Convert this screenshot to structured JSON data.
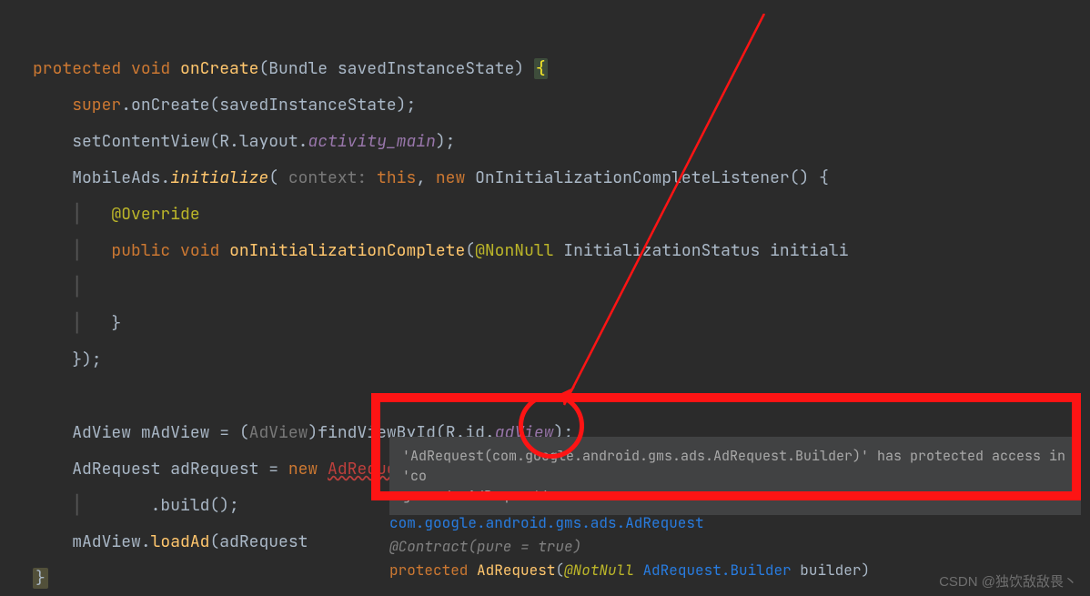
{
  "kw": {
    "protected": "protected",
    "void": "void",
    "super": "super",
    "this": "this",
    "new": "new",
    "public": "public"
  },
  "fn": {
    "onCreate": "onCreate",
    "initialize": "initialize",
    "onInitializationComplete": "onInitializationComplete",
    "loadAd": "loadAd",
    "setContentView": "setContentView",
    "findViewById": "findViewById",
    "build": "build"
  },
  "id": {
    "Bundle": "Bundle",
    "savedInstanceState": "savedInstanceState",
    "savedInstanceStateArg": "savedInstanceState",
    "R": "R",
    "layout": "layout",
    "MobileAds": "MobileAds",
    "contextHint": "context:",
    "OnListener": "OnInitializationCompleteListener",
    "InitStatus": "InitializationStatus",
    "initParam": "initiali",
    "AdView": "AdView",
    "mAdView": "mAdView",
    "id": "id",
    "adView": "adView",
    "AdRequest": "AdRequest",
    "adRequest": "adRequest",
    "Builder": "Builder",
    "adRequestArg": "adRequest",
    "mAdView2": "mAdView"
  },
  "fld": {
    "activity_main": "activity_main"
  },
  "ann": {
    "Override": "@Override",
    "NonNull": "@NonNull"
  },
  "popup": {
    "line1": "'AdRequest(com.google.android.gms.ads.AdRequest.Builder)' has protected access in 'co",
    "line2": "gms.ads.AdRequest'"
  },
  "doc": {
    "pkg": "com.google.android.gms.ads.AdRequest",
    "contract": "@Contract(pure = true)",
    "sig_pre": "protected ",
    "sig_name": "AdRequest",
    "sig_paren": "(",
    "sig_ann": "@NotNull",
    "sig_type": " AdRequest.Builder ",
    "sig_arg": "builder",
    "sig_close": ")"
  },
  "watermark": "CSDN @独饮敌敌畏丶"
}
